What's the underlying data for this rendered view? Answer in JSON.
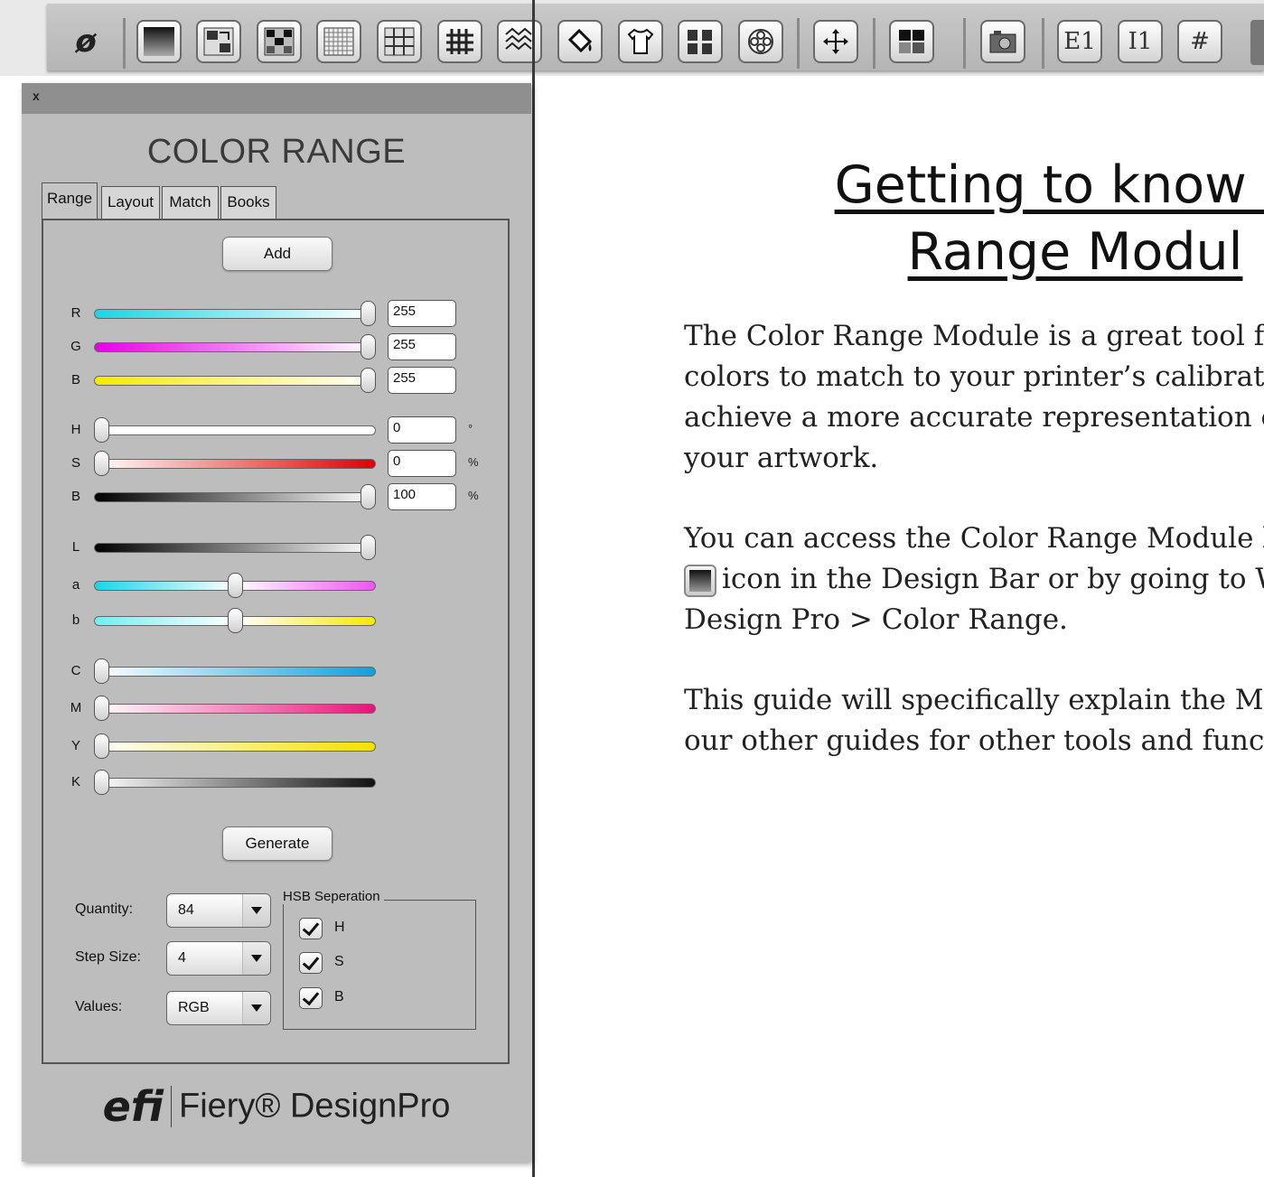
{
  "toolbar": {
    "logo_glyph": "ø",
    "buttons": [
      {
        "name": "color-range-icon"
      },
      {
        "name": "image-swap-icon"
      },
      {
        "name": "pattern-grid-icon"
      },
      {
        "name": "fine-grid-icon"
      },
      {
        "name": "tile-grid-icon"
      },
      {
        "name": "weave-grid-icon"
      },
      {
        "name": "repeat-pattern-icon"
      },
      {
        "name": "paint-bucket-icon"
      },
      {
        "name": "shirt-icon"
      },
      {
        "name": "multi-shirt-icon"
      },
      {
        "name": "flower-icon"
      },
      {
        "name": "move-icon"
      },
      {
        "name": "layout-icon"
      },
      {
        "name": "camera-icon"
      },
      {
        "name": "e1-icon",
        "text": "E1"
      },
      {
        "name": "i1-icon",
        "text": "I1"
      },
      {
        "name": "hash-icon",
        "text": "#"
      }
    ]
  },
  "panel": {
    "close_label": "x",
    "title": "COLOR RANGE",
    "tabs": [
      "Range",
      "Layout",
      "Match",
      "Books"
    ],
    "add_label": "Add",
    "generate_label": "Generate",
    "sliders": {
      "R": {
        "label": "R",
        "value": "255",
        "level": 1.0
      },
      "G": {
        "label": "G",
        "value": "255",
        "level": 1.0
      },
      "B": {
        "label": "B",
        "value": "255",
        "level": 1.0
      },
      "H": {
        "label": "H",
        "value": "0",
        "unit": "°",
        "level": 0.0
      },
      "S": {
        "label": "S",
        "value": "0",
        "unit": "%",
        "level": 0.0
      },
      "Br": {
        "label": "B",
        "value": "100",
        "unit": "%",
        "level": 1.0
      },
      "L": {
        "label": "L",
        "level": 1.0
      },
      "a": {
        "label": "a",
        "level": 0.5
      },
      "b": {
        "label": "b",
        "level": 0.5
      },
      "C": {
        "label": "C",
        "level": 0.0
      },
      "M": {
        "label": "M",
        "level": 0.0
      },
      "Y": {
        "label": "Y",
        "level": 0.0
      },
      "K": {
        "label": "K",
        "level": 0.0
      }
    },
    "quantity_label": "Quantity:",
    "quantity_value": "84",
    "step_label": "Step Size:",
    "step_value": "4",
    "values_label": "Values:",
    "values_value": "RGB",
    "hsb_group_title": "HSB Seperation",
    "hsb_checks": [
      {
        "label": "H",
        "checked": true
      },
      {
        "label": "S",
        "checked": true
      },
      {
        "label": "B",
        "checked": true
      }
    ],
    "brand_efi": "efi",
    "brand_name": "Fiery® DesignPro"
  },
  "article": {
    "title_line1": "Getting to know th",
    "title_line2": "Range Modul",
    "p1": [
      "The Color Range Module is a great tool for",
      "colors to match to your printer’s calibration",
      "achieve a more accurate representation of th",
      "your artwork."
    ],
    "p2_line1": "You can access the Color Range Module by",
    "p2_line2": "icon in the Design Bar or by going to W",
    "p2_line3": "Design Pro > Color Range.",
    "p3": [
      "This guide will specifically explain the Matc",
      "our other guides for other tools and functio"
    ]
  }
}
